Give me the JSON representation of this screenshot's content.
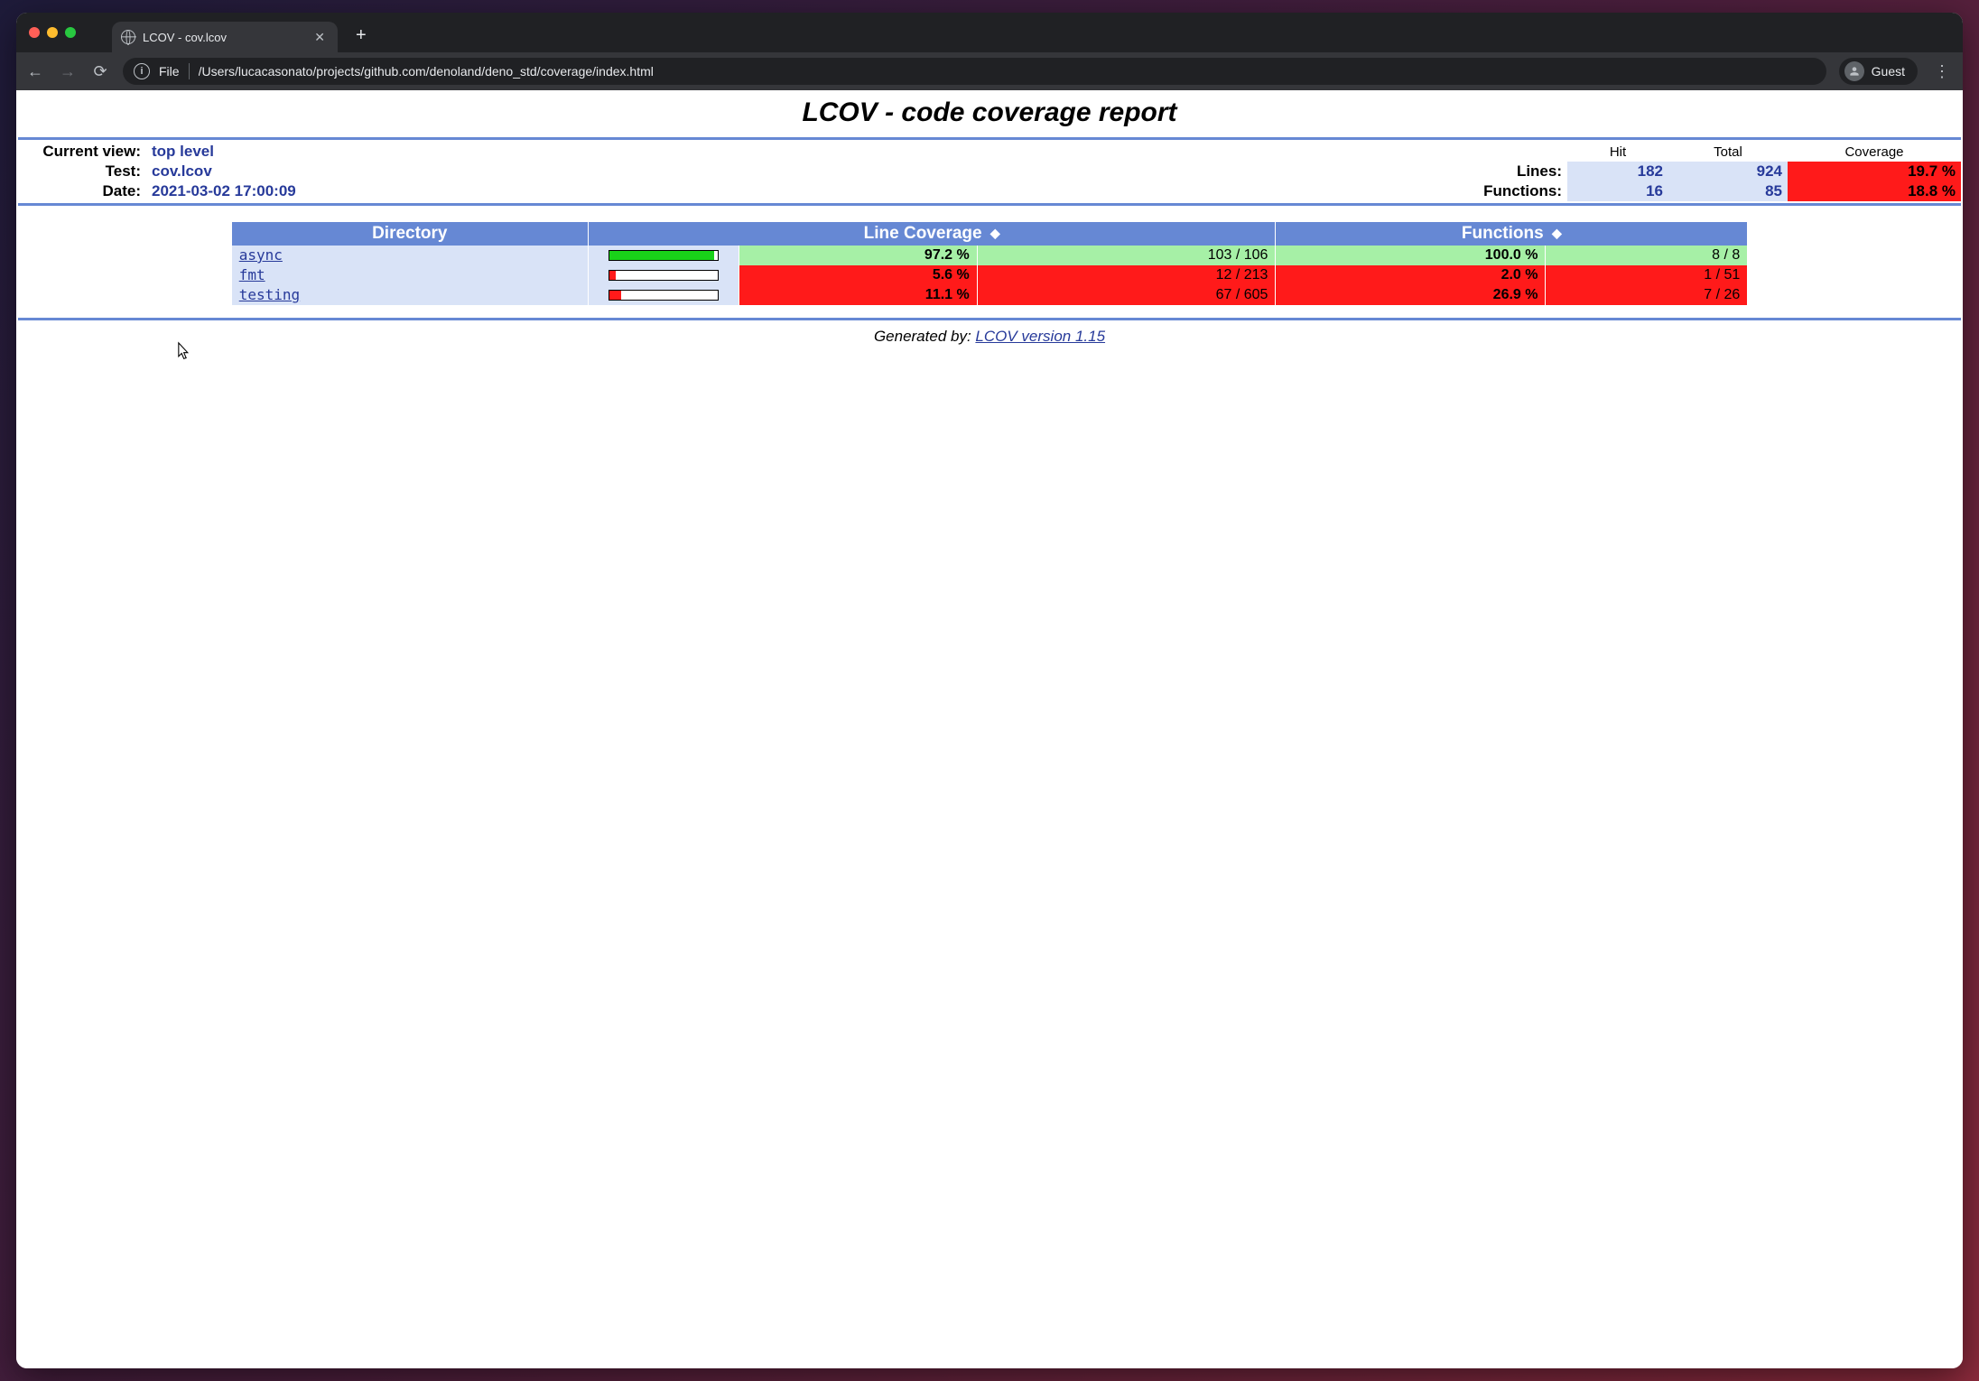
{
  "browser": {
    "tab_title": "LCOV - cov.lcov",
    "url_scheme": "File",
    "url_path": "/Users/lucacasonato/projects/github.com/denoland/deno_std/coverage/index.html",
    "profile_label": "Guest"
  },
  "report": {
    "title": "LCOV - code coverage report",
    "summary_labels": {
      "current_view": "Current view:",
      "test": "Test:",
      "date": "Date:",
      "lines": "Lines:",
      "functions": "Functions:",
      "hit": "Hit",
      "total": "Total",
      "coverage": "Coverage"
    },
    "summary_values": {
      "current_view": "top level",
      "test": "cov.lcov",
      "date": "2021-03-02 17:00:09",
      "lines_hit": "182",
      "lines_total": "924",
      "lines_cov": "19.7 %",
      "funcs_hit": "16",
      "funcs_total": "85",
      "funcs_cov": "18.8 %"
    },
    "columns": {
      "directory": "Directory",
      "line_coverage": "Line Coverage",
      "functions": "Functions"
    },
    "rows": [
      {
        "name": "async",
        "line_pct": "97.2 %",
        "line_frac": "103 / 106",
        "bar_pct": 97.2,
        "bar_class": "bar-green",
        "line_class": "bg-green",
        "func_pct": "100.0 %",
        "func_frac": "8 / 8",
        "func_class": "bg-green"
      },
      {
        "name": "fmt",
        "line_pct": "5.6 %",
        "line_frac": "12 / 213",
        "bar_pct": 5.6,
        "bar_class": "bar-red",
        "line_class": "bg-red",
        "func_pct": "2.0 %",
        "func_frac": "1 / 51",
        "func_class": "bg-red"
      },
      {
        "name": "testing",
        "line_pct": "11.1 %",
        "line_frac": "67 / 605",
        "bar_pct": 11.1,
        "bar_class": "bar-red",
        "line_class": "bg-red",
        "func_pct": "26.9 %",
        "func_frac": "7 / 26",
        "func_class": "bg-red"
      }
    ],
    "footer_prefix": "Generated by: ",
    "footer_link_text": "LCOV version 1.15"
  },
  "chart_data": {
    "type": "table",
    "title": "LCOV - code coverage report",
    "summary": {
      "lines": {
        "hit": 182,
        "total": 924,
        "coverage_pct": 19.7
      },
      "functions": {
        "hit": 16,
        "total": 85,
        "coverage_pct": 18.8
      }
    },
    "rows": [
      {
        "directory": "async",
        "lines_hit": 103,
        "lines_total": 106,
        "line_cov_pct": 97.2,
        "funcs_hit": 8,
        "funcs_total": 8,
        "func_cov_pct": 100.0
      },
      {
        "directory": "fmt",
        "lines_hit": 12,
        "lines_total": 213,
        "line_cov_pct": 5.6,
        "funcs_hit": 1,
        "funcs_total": 51,
        "func_cov_pct": 2.0
      },
      {
        "directory": "testing",
        "lines_hit": 67,
        "lines_total": 605,
        "line_cov_pct": 11.1,
        "funcs_hit": 7,
        "funcs_total": 26,
        "func_cov_pct": 26.9
      }
    ]
  }
}
